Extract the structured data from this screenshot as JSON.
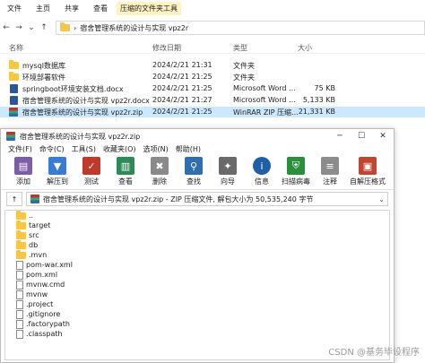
{
  "explorer": {
    "ribbon": [
      "文件",
      "主页",
      "共享",
      "查看",
      "压缩的文件夹工具"
    ],
    "address_path": "宿舍管理系统的设计与实现 vpz2r",
    "columns": {
      "name": "名称",
      "date": "修改日期",
      "type": "类型",
      "size": "大小"
    },
    "files": [
      {
        "name": "mysql数据库",
        "date": "2024/2/21 21:31",
        "type": "文件夹",
        "size": "",
        "icon": "folder-icon"
      },
      {
        "name": "环境部署软件",
        "date": "2024/2/21 21:25",
        "type": "文件夹",
        "size": "",
        "icon": "folder-icon"
      },
      {
        "name": "springboot环境安装文档.docx",
        "date": "2024/2/21 21:25",
        "type": "Microsoft Word ...",
        "size": "75 KB",
        "icon": "word-doc-icon"
      },
      {
        "name": "宿舍管理系统的设计与实现 vpz2r.docx",
        "date": "2024/2/21 21:27",
        "type": "Microsoft Word ...",
        "size": "5,133 KB",
        "icon": "word-doc-icon"
      },
      {
        "name": "宿舍管理系统的设计与实现 vpz2r.zip",
        "date": "2024/2/21 21:25",
        "type": "WinRAR ZIP 压缩...",
        "size": "21,331 KB",
        "icon": "zip-archive-icon"
      }
    ]
  },
  "winrar": {
    "title": "宿舍管理系统的设计与实现 vpz2r.zip",
    "menu": [
      "文件(F)",
      "命令(C)",
      "工具(S)",
      "收藏夹(O)",
      "选项(N)",
      "帮助(H)"
    ],
    "toolbar": [
      {
        "label": "添加",
        "icon": "add-archive-icon",
        "color": "#7b5ea7"
      },
      {
        "label": "解压到",
        "icon": "extract-folder-icon",
        "color": "#3a7bd5"
      },
      {
        "label": "测试",
        "icon": "test-check-icon",
        "color": "#c0392b"
      },
      {
        "label": "查看",
        "icon": "view-book-icon",
        "color": "#2e8b57"
      },
      {
        "label": "删除",
        "icon": "delete-icon",
        "color": "#8a8a8a"
      },
      {
        "label": "查找",
        "icon": "find-magnifier-icon",
        "color": "#2f6fb0"
      },
      {
        "label": "向导",
        "icon": "wizard-wand-icon",
        "color": "#6a6a6a"
      },
      {
        "label": "信息",
        "icon": "info-icon",
        "color": "#1f5fa8"
      },
      {
        "label": "扫描病毒",
        "icon": "virus-scan-icon",
        "color": "#2a8f3a"
      },
      {
        "label": "注释",
        "icon": "comment-icon",
        "color": "#8c8c8c"
      },
      {
        "label": "自解压格式",
        "icon": "sfx-archive-icon",
        "color": "#c0462f"
      }
    ],
    "path": "宿舍管理系统的设计与实现 vpz2r.zip - ZIP 压缩文件, 解包大小为 50,535,240 字节",
    "entries": [
      {
        "name": "..",
        "kind": "folder"
      },
      {
        "name": "target",
        "kind": "folder"
      },
      {
        "name": "src",
        "kind": "folder"
      },
      {
        "name": "db",
        "kind": "folder"
      },
      {
        "name": ".mvn",
        "kind": "folder"
      },
      {
        "name": "pom-war.xml",
        "kind": "file"
      },
      {
        "name": "pom.xml",
        "kind": "file"
      },
      {
        "name": "mvnw.cmd",
        "kind": "file"
      },
      {
        "name": "mvnw",
        "kind": "file"
      },
      {
        "name": ".project",
        "kind": "file"
      },
      {
        "name": ".gitignore",
        "kind": "file"
      },
      {
        "name": ".factorypath",
        "kind": "file"
      },
      {
        "name": ".classpath",
        "kind": "file"
      }
    ]
  },
  "watermark": "CSDN @基务毕设程序"
}
